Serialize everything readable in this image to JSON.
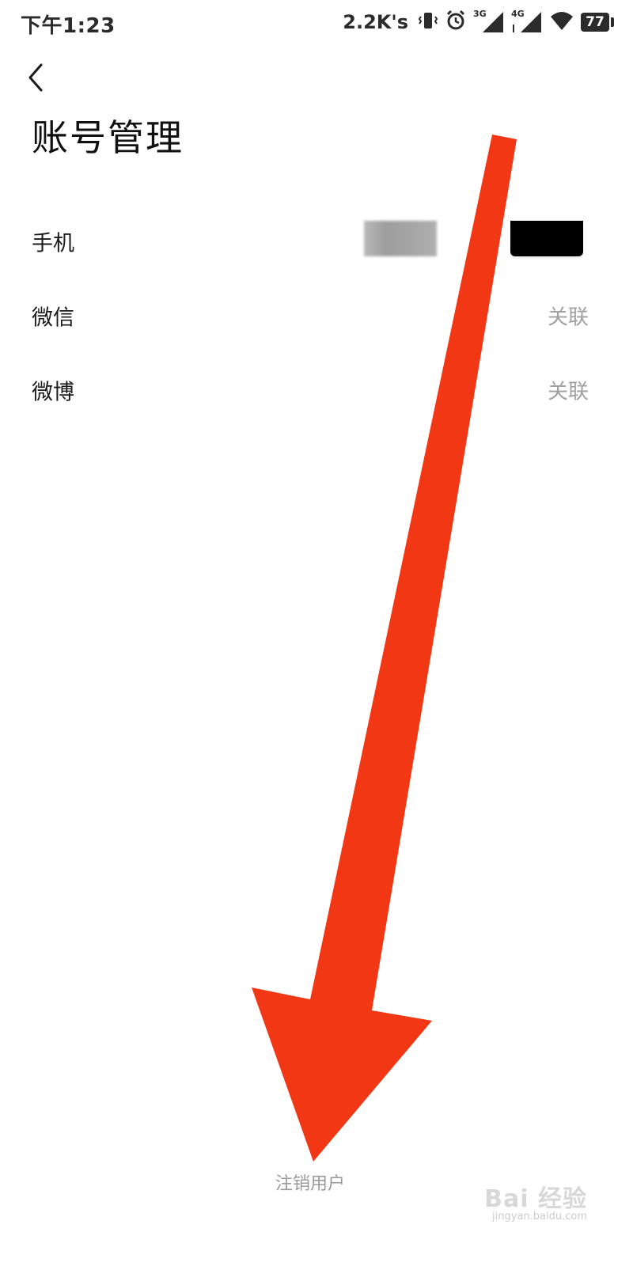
{
  "status_bar": {
    "time": "下午1:23",
    "net_speed": "2.2K's",
    "signal_1_label": "3G",
    "signal_2_label": "4G",
    "battery": "77"
  },
  "header": {
    "title": "账号管理"
  },
  "rows": [
    {
      "label": "手机",
      "value": ""
    },
    {
      "label": "微信",
      "value": "关联"
    },
    {
      "label": "微博",
      "value": "关联"
    }
  ],
  "footer": {
    "logout_label": "注销用户"
  },
  "watermark": {
    "text": "Bai 经验",
    "sub": "jingyan.baidu.com"
  },
  "colors": {
    "annotation_arrow": "#f23714",
    "secondary_text": "#a0a0a0"
  }
}
